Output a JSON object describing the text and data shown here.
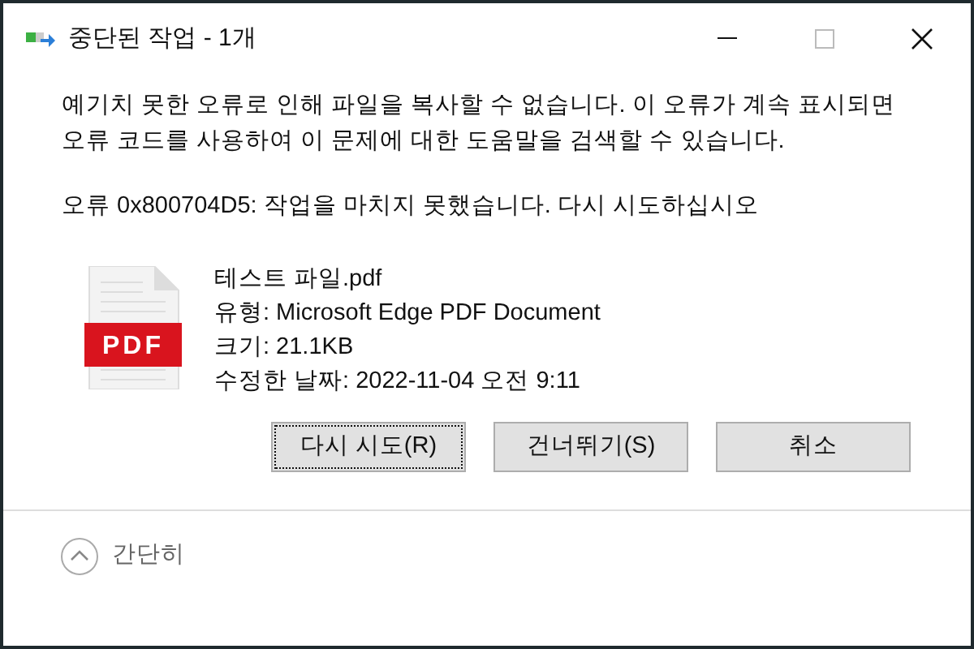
{
  "window": {
    "title": "중단된 작업 - 1개"
  },
  "message": "예기치 못한 오류로 인해 파일을 복사할 수 없습니다. 이 오류가 계속 표시되면 오류 코드를 사용하여 이 문제에 대한 도움말을 검색할 수 있습니다.",
  "error": "오류 0x800704D5: 작업을 마치지 못했습니다. 다시 시도하십시오",
  "file": {
    "name": "테스트 파일.pdf",
    "type": "유형: Microsoft Edge PDF Document",
    "size": "크기: 21.1KB",
    "modified": "수정한 날짜: 2022-11-04 오전 9:11",
    "icon_label": "PDF"
  },
  "buttons": [
    {
      "label": "다시 시도(R)",
      "focused": true
    },
    {
      "label": "건너뛰기(S)",
      "focused": false
    },
    {
      "label": "취소",
      "focused": false
    }
  ],
  "footer": {
    "label": "간단히"
  }
}
